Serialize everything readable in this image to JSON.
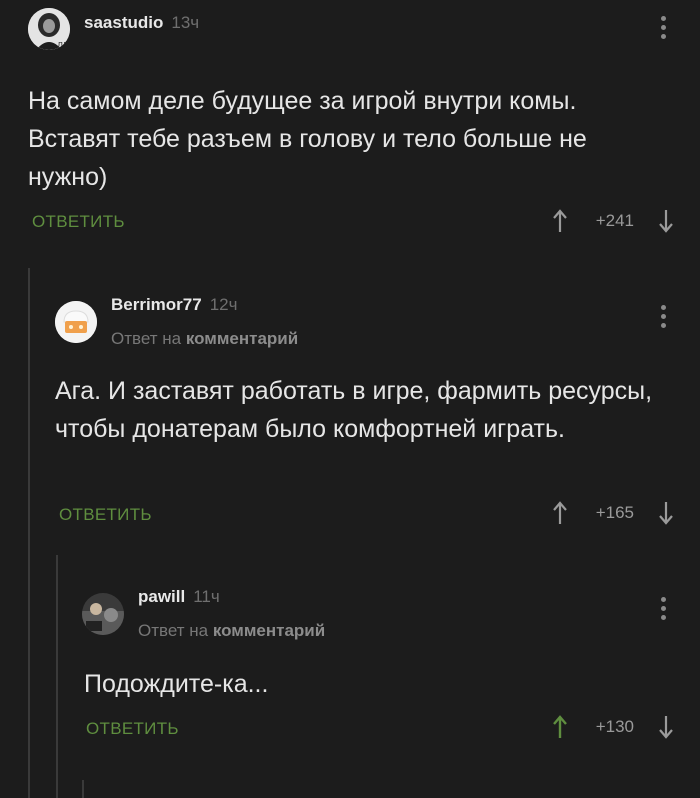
{
  "comments": [
    {
      "username": "saastudio",
      "time": "13ч",
      "text": "На самом деле будущее за игрой внутри комы. Вставят тебе разъем в голову и тело больше не нужно)",
      "reply_label": "ОТВЕТИТЬ",
      "score": "+241",
      "up_active": false
    },
    {
      "username": "Berrimor77",
      "time": "12ч",
      "reply_to_prefix": "Ответ на",
      "reply_to_target": "комментарий",
      "text": "Ага. И заставят работать в игре, фармить ресурсы, чтобы донатерам было комфортней играть.",
      "reply_label": "ОТВЕТИТЬ",
      "score": "+165",
      "up_active": false
    },
    {
      "username": "pawill",
      "time": "11ч",
      "reply_to_prefix": "Ответ на",
      "reply_to_target": "комментарий",
      "text": "Подождите-ка...",
      "reply_label": "ОТВЕТИТЬ",
      "score": "+130",
      "up_active": true
    }
  ],
  "colors": {
    "background": "#1c1c1c",
    "reply_green": "#5f8e3f",
    "arrow_gray": "#9a9a9a",
    "arrow_active": "#5f8e3f"
  },
  "icons": [
    "more-vertical-icon",
    "arrow-up-icon",
    "arrow-down-icon"
  ]
}
